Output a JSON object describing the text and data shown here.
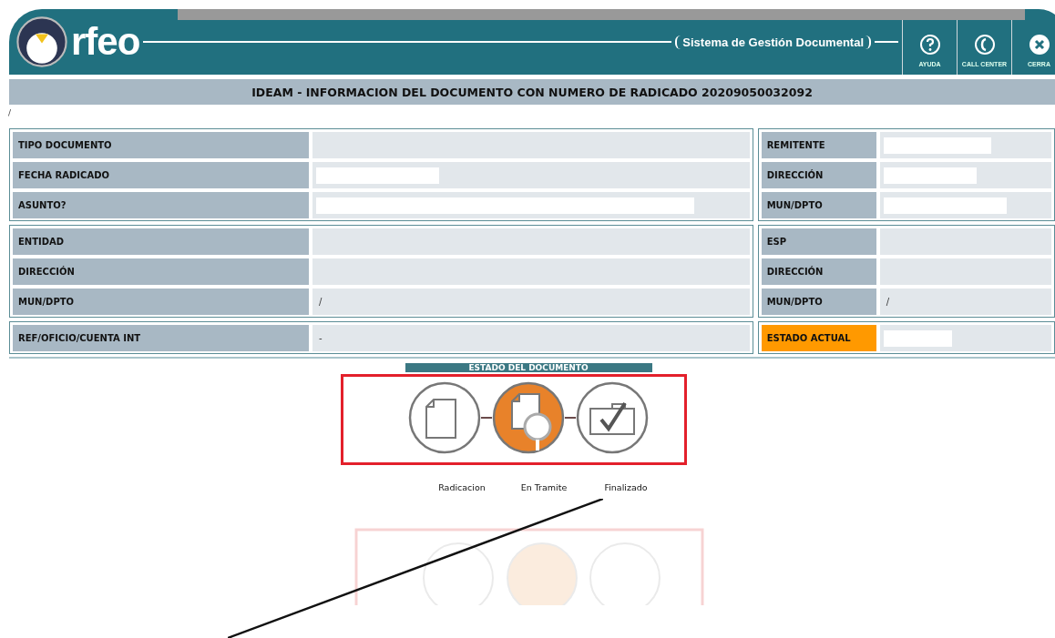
{
  "header": {
    "brand": "rfeo",
    "subtitle": "Sistema de Gestión Documental",
    "actions": [
      {
        "kind": "help",
        "label": "AYUDA"
      },
      {
        "kind": "phone",
        "label": "CALL CENTER"
      },
      {
        "kind": "close",
        "label": "CERRA"
      }
    ]
  },
  "title": "IDEAM - INFORMACION DEL DOCUMENTO CON NUMERO DE RADICADO 20209050032092",
  "breadcrumb": "/",
  "sections": [
    {
      "left": [
        {
          "label": "TIPO DOCUMENTO",
          "kind": "text"
        },
        {
          "label": "FECHA RADICADO",
          "kind": "field"
        },
        {
          "label": "ASUNTO?",
          "kind": "field"
        }
      ],
      "right": [
        {
          "label": "REMITENTE",
          "kind": "field",
          "highlighted": false
        },
        {
          "label": "DIRECCIÓN",
          "kind": "field",
          "highlighted": false
        },
        {
          "label": "MUN/DPTO",
          "kind": "field",
          "highlighted": false
        }
      ]
    },
    {
      "left": [
        {
          "label": "ENTIDAD",
          "kind": "text"
        },
        {
          "label": "DIRECCIÓN",
          "kind": "text"
        },
        {
          "label": "MUN/DPTO",
          "kind": "text",
          "value": "/"
        }
      ],
      "right": [
        {
          "label": "ESP",
          "kind": "text",
          "highlighted": false
        },
        {
          "label": "DIRECCIÓN",
          "kind": "text",
          "highlighted": false
        },
        {
          "label": "MUN/DPTO",
          "kind": "text",
          "value": "/",
          "highlighted": false
        }
      ]
    },
    {
      "left": [
        {
          "label": "REF/OFICIO/CUENTA INT",
          "kind": "text",
          "value": "-"
        }
      ],
      "right": [
        {
          "label": "ESTADO ACTUAL",
          "kind": "field",
          "highlighted": true
        }
      ]
    }
  ],
  "status": {
    "heading": "ESTADO DEL DOCUMENTO",
    "steps": [
      {
        "kind": "document",
        "label": "Radicacion",
        "selected": false
      },
      {
        "kind": "review",
        "label": "En Tramite",
        "selected": true
      },
      {
        "kind": "done",
        "label": "Finalizado",
        "selected": false
      }
    ]
  }
}
